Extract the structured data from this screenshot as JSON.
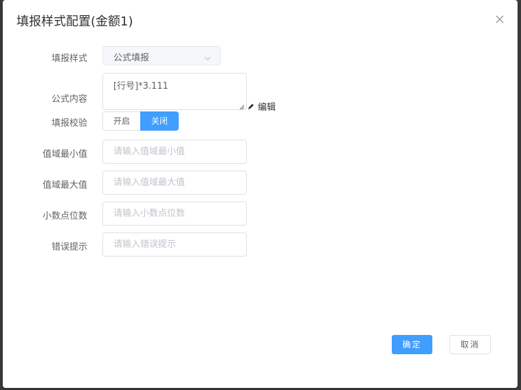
{
  "dialog": {
    "title": "填报样式配置(金额1)",
    "close_icon": "close-icon"
  },
  "form": {
    "style": {
      "label": "填报样式",
      "value": "公式填报",
      "icon": "chevron-down-icon"
    },
    "formula": {
      "label": "公式内容",
      "value": "[行号]*3.111",
      "edit_label": "编辑",
      "edit_icon": "pencil-icon"
    },
    "validation": {
      "label": "填报校验",
      "option_on": "开启",
      "option_off": "关闭",
      "selected": "关闭"
    },
    "min_value": {
      "label": "值域最小值",
      "placeholder": "请输入值域最小值"
    },
    "max_value": {
      "label": "值域最大值",
      "placeholder": "请输入值域最大值"
    },
    "decimals": {
      "label": "小数点位数",
      "placeholder": "请输入小数点位数"
    },
    "error_hint": {
      "label": "错误提示",
      "placeholder": "请输入错误提示"
    }
  },
  "footer": {
    "confirm_label": "确定",
    "cancel_label": "取消"
  },
  "colors": {
    "primary": "#409eff",
    "text": "#606266",
    "placeholder": "#c0c4cc",
    "border": "#dcdfe6"
  }
}
